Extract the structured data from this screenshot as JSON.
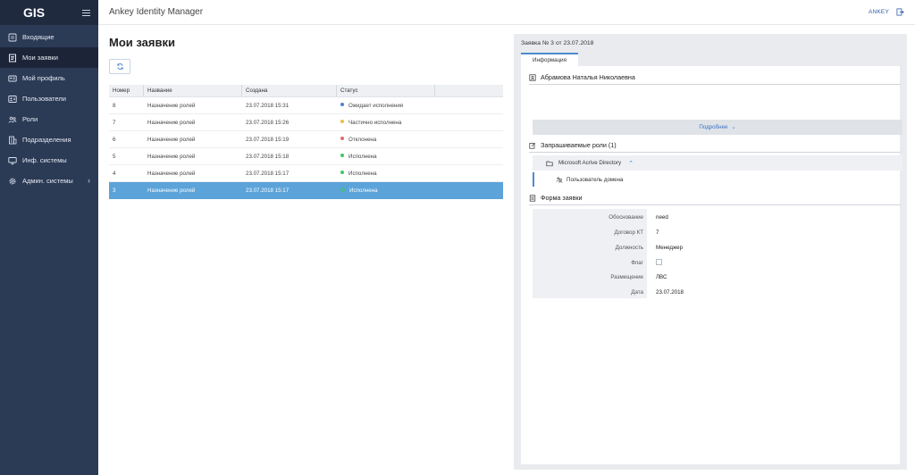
{
  "app": {
    "title": "Ankey Identity Manager",
    "logo_text": "GIS"
  },
  "user": {
    "name": "ANKEY"
  },
  "sidebar": {
    "items": [
      {
        "label": "Входящие",
        "icon": "inbox-icon"
      },
      {
        "label": "Мои заявки",
        "icon": "requests-icon",
        "active": true
      },
      {
        "label": "Мой профиль",
        "icon": "profile-card-icon"
      },
      {
        "label": "Пользователи",
        "icon": "users-icon"
      },
      {
        "label": "Роли",
        "icon": "roles-icon"
      },
      {
        "label": "Подразделения",
        "icon": "departments-icon"
      },
      {
        "label": "Инф. системы",
        "icon": "info-systems-icon"
      },
      {
        "label": "Админ. системы",
        "icon": "admin-gear-icon",
        "has_submenu": true
      }
    ]
  },
  "main": {
    "title": "Мои заявки",
    "table": {
      "columns": [
        "Номер",
        "Название",
        "Создана",
        "Статус",
        ""
      ],
      "rows": [
        {
          "number": "8",
          "name": "Назначение ролей",
          "created": "23.07.2018 15:31",
          "status": "Ожидает исполнения",
          "status_color": "#4e7fd1"
        },
        {
          "number": "7",
          "name": "Назначение ролей",
          "created": "23.07.2018 15:26",
          "status": "Частично исполнена",
          "status_color": "#e9c03d"
        },
        {
          "number": "6",
          "name": "Назначение ролей",
          "created": "23.07.2018 15:19",
          "status": "Отклонена",
          "status_color": "#e06a6a"
        },
        {
          "number": "5",
          "name": "Назначение ролей",
          "created": "23.07.2018 15:18",
          "status": "Исполнена",
          "status_color": "#3fc46a"
        },
        {
          "number": "4",
          "name": "Назначение ролей",
          "created": "23.07.2018 15:17",
          "status": "Исполнена",
          "status_color": "#3fc46a"
        },
        {
          "number": "3",
          "name": "Назначение ролей",
          "created": "23.07.2018 15:17",
          "status": "Исполнена",
          "status_color": "#3fc46a",
          "selected": true
        }
      ]
    }
  },
  "detail": {
    "title": "Заявка № 3 от 23.07.2018",
    "tab": "Информация",
    "person": "Абрамова Наталья Николаевна",
    "more_label": "Подробнее",
    "roles_header": "Запрашиваемые роли (1)",
    "system_name": "Microsoft Acrive Directory",
    "role_name": "Пользователь домена",
    "form_header": "Форма заявки",
    "form": [
      {
        "label": "Обоснование",
        "value": "need"
      },
      {
        "label": "Договор КТ",
        "value": "7"
      },
      {
        "label": "Должность",
        "value": "Менеджер"
      },
      {
        "label": "Флаг",
        "value": "",
        "type": "checkbox"
      },
      {
        "label": "Размещение",
        "value": "ЛВС"
      },
      {
        "label": "Дата",
        "value": "23.07.2018"
      }
    ]
  },
  "colors": {
    "sidebar": "#2b3a55",
    "sidebar_active": "#1c2538",
    "selected_row": "#5ba3d9",
    "accent": "#4d8bd1"
  }
}
